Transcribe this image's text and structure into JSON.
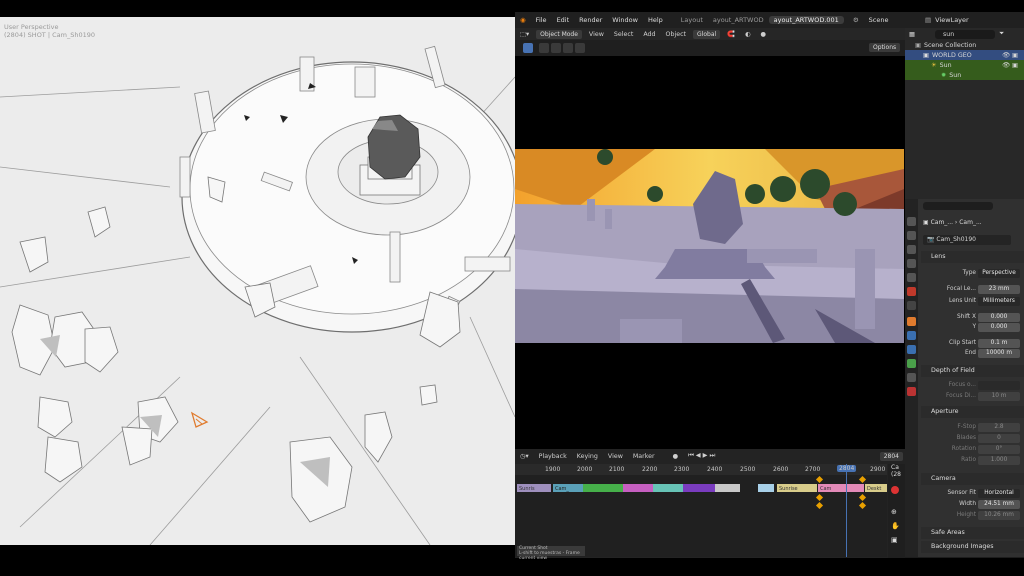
{
  "left_viewport": {
    "label_line1": "User Perspective",
    "label_line2": "(2804) SHOT | Cam_Sh0190"
  },
  "topbar": {
    "menus": [
      "File",
      "Edit",
      "Render",
      "Window",
      "Help"
    ],
    "workspaces": [
      "Layout",
      "ayout_ARTWOD",
      "ayout_ARTWOD.001"
    ],
    "active_workspace": "ayout_ARTWOD.001",
    "scene_label": "Scene",
    "scene_number": "23",
    "view_layer": "ViewLayer"
  },
  "viewport_header": {
    "mode": "Object Mode",
    "menus": [
      "View",
      "Select",
      "Add",
      "Object"
    ],
    "orientation": "Global",
    "options": "Options"
  },
  "timeline": {
    "menus": [
      "Playback",
      "Keying",
      "View",
      "Marker"
    ],
    "current_frame": "2804",
    "ruler": [
      "1900",
      "2000",
      "2100",
      "2200",
      "2300",
      "2400",
      "2500",
      "2600",
      "2700",
      "2804",
      "2900"
    ],
    "strip_labels": [
      "Sunris",
      "Cam_",
      "Sunrise",
      "Cam",
      "Deskt"
    ],
    "status_text": "Current Shot",
    "status_sub": "L-shift to muestras - Frame current view"
  },
  "side_labels": {
    "cam_label": "Ca",
    "cam_frame": "(28"
  },
  "outliner": {
    "search": "sun",
    "rows": [
      "Scene Collection",
      "WORLD GEO",
      "Sun",
      "Sun"
    ]
  },
  "properties": {
    "breadcrumb_a": "Cam_...",
    "breadcrumb_b": "Cam_...",
    "camera_name": "Cam_Sh0190",
    "lens_section": "Lens",
    "type_label": "Type",
    "type_value": "Perspective",
    "focal_label": "Focal Le...",
    "focal_value": "23 mm",
    "lens_unit_label": "Lens Unit",
    "lens_unit_value": "Millimeters",
    "shift_x_label": "Shift X",
    "shift_x_value": "0.000",
    "shift_y_label": "Y",
    "shift_y_value": "0.000",
    "clip_start_label": "Clip Start",
    "clip_start_value": "0.1 m",
    "clip_end_label": "End",
    "clip_end_value": "10000 m",
    "dof_section": "Depth of Field",
    "focus_obj_label": "Focus o...",
    "focus_dist_label": "Focus Di...",
    "focus_dist_value": "10 m",
    "aperture_section": "Aperture",
    "fstop_label": "F-Stop",
    "fstop_value": "2.8",
    "blades_label": "Blades",
    "blades_value": "0",
    "rotation_label": "Rotation",
    "rotation_value": "0°",
    "ratio_label": "Ratio",
    "ratio_value": "1.000",
    "camera_section": "Camera",
    "sensor_fit_label": "Sensor Fit",
    "sensor_fit_value": "Horizontal",
    "width_label": "Width",
    "width_value": "24.51 mm",
    "height_label": "Height",
    "height_value": "10.26 mm",
    "safe_areas_section": "Safe Areas",
    "bg_images_section": "Background Images"
  },
  "colors": {
    "accent": "#4772b3",
    "selection": "#334d80",
    "highlight_green": "#355c1c",
    "keyframe": "#e8a000"
  }
}
